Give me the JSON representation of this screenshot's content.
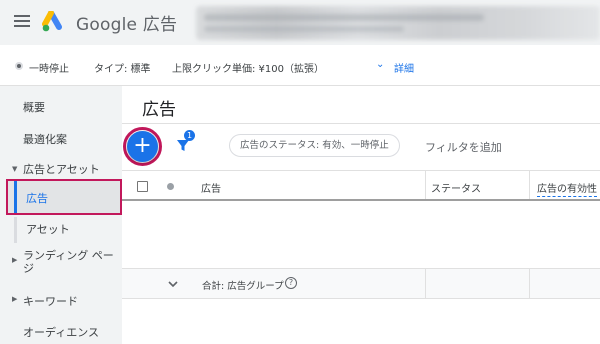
{
  "header": {
    "brand_title": "Google 広告"
  },
  "settings": {
    "status": "一時停止",
    "type": "タイプ: 標準",
    "max_cpc": "上限クリック単価: ¥100（拡張）",
    "details_label": "詳細"
  },
  "sidebar": {
    "items": [
      {
        "label": "概要"
      },
      {
        "label": "最適化案"
      },
      {
        "label": "広告とアセット"
      },
      {
        "label": "広告"
      },
      {
        "label": "アセット"
      },
      {
        "label": "ランディング ページ"
      },
      {
        "label": "キーワード"
      },
      {
        "label": "オーディエンス"
      }
    ]
  },
  "main": {
    "title": "広告",
    "add_button": "+",
    "filter_badge": "1",
    "filter_chip": "広告のステータス: 有効、一時停止",
    "add_filter": "フィルタを追加",
    "columns": [
      "広告",
      "ステータス",
      "広告の有効性"
    ],
    "total_label": "合計: 広告グループ",
    "help_glyph": "?"
  },
  "colors": {
    "accent": "#1a73e8",
    "highlight": "#c2185b",
    "sidebar_bg": "#f1f3f4"
  }
}
